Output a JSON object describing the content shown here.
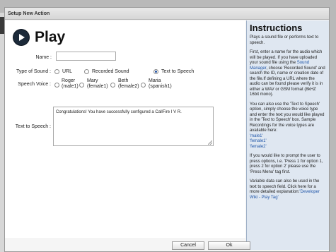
{
  "window": {
    "title": "Setup New Action"
  },
  "header": {
    "title": "Play"
  },
  "form": {
    "name_label": "Name :",
    "name_value": "",
    "type_label": "Type of Sound :",
    "type_options": [
      "URL",
      "Recorded Sound",
      "Text to Speech"
    ],
    "type_selected": "Text to Speech",
    "voice_label": "Speech Voice :",
    "voice_options": [
      {
        "line1": "Roger",
        "line2": "(male1)"
      },
      {
        "line1": "Mary",
        "line2": "(female1)"
      },
      {
        "line1": "Beth",
        "line2": "(female2)"
      },
      {
        "line1": "Maria",
        "line2": "(spanish1)"
      }
    ],
    "tts_label": "Text to Speech :",
    "tts_value": "Congratulations! You have successfully configured a CallFire I V R."
  },
  "instructions": {
    "title": "Instructions",
    "p1": "Plays a sound file or performs text to speech.",
    "p2_a": "First, enter a name for the audio which will be played. If you have uploaded your sound file using the",
    "p2_link": "Sound Manager",
    "p2_b": ", choose 'Recorded Sound' and search the ID, name or creation date of the file.If defining a URL where the audio can be found please verify it is in either a WAV or GSM format (8kHZ 16bit mono).",
    "p3": "You can also use the 'Text to Speech' option, simply choose the voice type and enter the text you would like played in the 'Text to Speech' box. Sample Recordings for the voice types are available here:",
    "voice_links": [
      "'male1'",
      "'female1'",
      "'female2'"
    ],
    "p4": "If you would like to prompt the user to press options, i.e. 'Press 1 for option 1, press 2 for option 2' please use the 'Press Menu' tag first.",
    "p5_a": "Variable data can also be used in the text to speech field. Click here for a more detailed explanation:",
    "p5_link": "'Developer Wiki - Play Tag'"
  },
  "buttons": {
    "cancel": "Cancel",
    "ok": "Ok"
  },
  "colors": {
    "accent": "#2056a8",
    "sidebar_bg": "#dfe7f1",
    "icon_bg": "#1c2a3a"
  }
}
